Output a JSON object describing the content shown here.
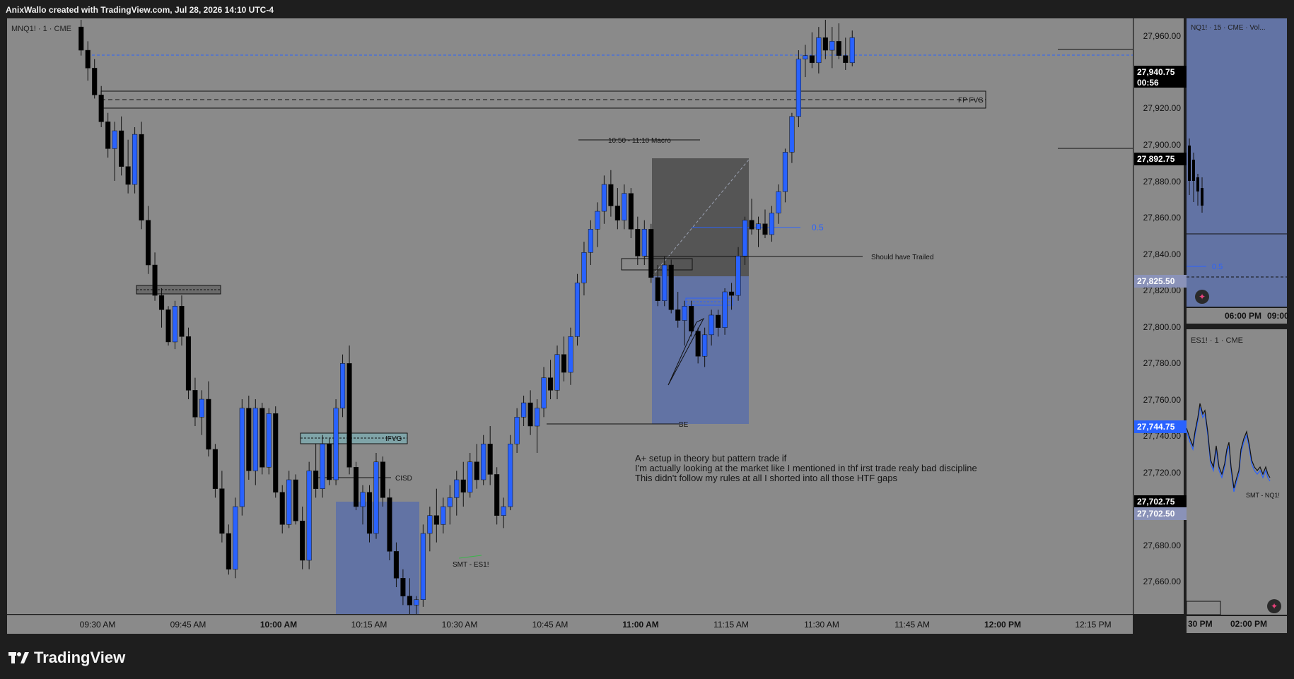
{
  "header": {
    "title": "AnixWallo created with TradingView.com, Jul 28, 2026 14:10 UTC-4"
  },
  "main": {
    "symbol": "MNQ1! · 1 · CME",
    "annotations": {
      "fp_fvg": "FP FVG",
      "macro": "10:50 - 11:10 Macro",
      "fib": "0.5",
      "trailed": "Should have Trailed",
      "ifvg": "IFVG",
      "cisd": "CISD",
      "be": "BE",
      "smt": "SMT - ES1!"
    },
    "note_lines": [
      "A+ setup in theory but pattern trade if",
      "I'm actually looking at the market like I mentioned in thf irst trade realy bad discipline",
      "This didn't follow my rules at all I shorted into all those HTF gaps"
    ]
  },
  "price_axis": {
    "ticks": [
      "27,960.00",
      "27,920.00",
      "27,900.00",
      "27,880.00",
      "27,860.00",
      "27,840.00",
      "27,820.00",
      "27,800.00",
      "27,780.00",
      "27,760.00",
      "27,740.00",
      "27,720.00",
      "27,680.00",
      "27,660.00"
    ],
    "tags": {
      "last": "27,940.75",
      "countdown": "00:56",
      "level_1": "27,892.75",
      "level_2": "27,825.50",
      "level_3": "27,744.75",
      "level_4": "27,702.75",
      "level_5": "27,702.50"
    }
  },
  "time_axis": {
    "ticks": [
      {
        "label": "09:30 AM",
        "bold": false
      },
      {
        "label": "09:45 AM",
        "bold": false
      },
      {
        "label": "10:00 AM",
        "bold": true
      },
      {
        "label": "10:15 AM",
        "bold": false
      },
      {
        "label": "10:30 AM",
        "bold": false
      },
      {
        "label": "10:45 AM",
        "bold": false
      },
      {
        "label": "11:00 AM",
        "bold": true
      },
      {
        "label": "11:15 AM",
        "bold": false
      },
      {
        "label": "11:30 AM",
        "bold": false
      },
      {
        "label": "11:45 AM",
        "bold": false
      },
      {
        "label": "12:00 PM",
        "bold": true
      },
      {
        "label": "12:15 PM",
        "bold": false
      }
    ]
  },
  "side_top": {
    "symbol": "NQ1! · 15 · CME · Vol...",
    "fib": "0.5",
    "time_left": "06:00 PM",
    "time_right": "09:00"
  },
  "side_bottom": {
    "symbol": "ES1! · 1 · CME",
    "smt": "SMT - NQ1!",
    "time_left": "30 PM",
    "time_right": "02:00 PM"
  },
  "brand": {
    "name": "TradingView"
  },
  "colors": {
    "up": "#2962ff",
    "down": "#000000",
    "pane": "#8a8a8a",
    "zone": "#5b6ea8"
  },
  "chart_data": {
    "type": "candlestick",
    "symbol": "MNQ1!",
    "interval": "1",
    "ylim": [
      27640,
      27972
    ],
    "x_ticks": [
      "09:30 AM",
      "09:45 AM",
      "10:00 AM",
      "10:15 AM",
      "10:30 AM",
      "10:45 AM",
      "11:00 AM",
      "11:15 AM",
      "11:30 AM",
      "11:45 AM",
      "12:00 PM",
      "12:15 PM"
    ],
    "candles": [
      [
        27968,
        27972,
        27952,
        27955
      ],
      [
        27955,
        27960,
        27938,
        27945
      ],
      [
        27945,
        27950,
        27928,
        27930
      ],
      [
        27930,
        27935,
        27912,
        27915
      ],
      [
        27915,
        27920,
        27895,
        27900
      ],
      [
        27900,
        27915,
        27882,
        27910
      ],
      [
        27910,
        27918,
        27885,
        27890
      ],
      [
        27890,
        27905,
        27875,
        27880
      ],
      [
        27880,
        27912,
        27875,
        27908
      ],
      [
        27908,
        27915,
        27855,
        27860
      ],
      [
        27860,
        27868,
        27830,
        27835
      ],
      [
        27835,
        27842,
        27815,
        27818
      ],
      [
        27818,
        27822,
        27800,
        27810
      ],
      [
        27810,
        27812,
        27790,
        27792
      ],
      [
        27792,
        27815,
        27788,
        27812
      ],
      [
        27812,
        27818,
        27790,
        27795
      ],
      [
        27795,
        27800,
        27760,
        27765
      ],
      [
        27765,
        27772,
        27745,
        27750
      ],
      [
        27750,
        27765,
        27740,
        27760
      ],
      [
        27760,
        27770,
        27728,
        27732
      ],
      [
        27732,
        27735,
        27705,
        27710
      ],
      [
        27710,
        27720,
        27680,
        27685
      ],
      [
        27685,
        27690,
        27662,
        27665
      ],
      [
        27665,
        27705,
        27660,
        27700
      ],
      [
        27700,
        27760,
        27695,
        27755
      ],
      [
        27755,
        27762,
        27715,
        27720
      ],
      [
        27720,
        27760,
        27712,
        27755
      ],
      [
        27755,
        27758,
        27718,
        27722
      ],
      [
        27722,
        27755,
        27718,
        27752
      ],
      [
        27752,
        27756,
        27705,
        27708
      ],
      [
        27708,
        27712,
        27685,
        27690
      ],
      [
        27690,
        27720,
        27688,
        27715
      ],
      [
        27715,
        27718,
        27690,
        27692
      ],
      [
        27692,
        27700,
        27665,
        27670
      ],
      [
        27670,
        27725,
        27665,
        27720
      ],
      [
        27720,
        27735,
        27705,
        27710
      ],
      [
        27710,
        27740,
        27705,
        27735
      ],
      [
        27735,
        27738,
        27712,
        27715
      ],
      [
        27715,
        27760,
        27712,
        27755
      ],
      [
        27755,
        27785,
        27750,
        27780
      ],
      [
        27780,
        27790,
        27718,
        27722
      ],
      [
        27722,
        27725,
        27698,
        27700
      ],
      [
        27700,
        27712,
        27690,
        27708
      ],
      [
        27708,
        27712,
        27680,
        27685
      ],
      [
        27685,
        27730,
        27682,
        27725
      ],
      [
        27725,
        27728,
        27700,
        27705
      ],
      [
        27705,
        27710,
        27670,
        27675
      ],
      [
        27675,
        27680,
        27655,
        27660
      ],
      [
        27660,
        27665,
        27645,
        27650
      ],
      [
        27650,
        27660,
        27640,
        27645
      ],
      [
        27645,
        27650,
        27640,
        27648
      ],
      [
        27648,
        27690,
        27644,
        27685
      ],
      [
        27685,
        27700,
        27675,
        27695
      ],
      [
        27695,
        27710,
        27680,
        27690
      ],
      [
        27690,
        27705,
        27685,
        27700
      ],
      [
        27700,
        27712,
        27690,
        27705
      ],
      [
        27705,
        27720,
        27695,
        27715
      ],
      [
        27715,
        27725,
        27700,
        27708
      ],
      [
        27708,
        27730,
        27705,
        27725
      ],
      [
        27725,
        27735,
        27710,
        27715
      ],
      [
        27715,
        27740,
        27712,
        27735
      ],
      [
        27735,
        27745,
        27712,
        27718
      ],
      [
        27718,
        27722,
        27690,
        27695
      ],
      [
        27695,
        27705,
        27688,
        27700
      ],
      [
        27700,
        27740,
        27698,
        27735
      ],
      [
        27735,
        27755,
        27730,
        27750
      ],
      [
        27750,
        27762,
        27745,
        27758
      ],
      [
        27758,
        27765,
        27740,
        27745
      ],
      [
        27745,
        27760,
        27730,
        27755
      ],
      [
        27755,
        27778,
        27750,
        27772
      ],
      [
        27772,
        27782,
        27760,
        27765
      ],
      [
        27765,
        27790,
        27760,
        27785
      ],
      [
        27785,
        27795,
        27770,
        27775
      ],
      [
        27775,
        27800,
        27768,
        27795
      ],
      [
        27795,
        27830,
        27790,
        27825
      ],
      [
        27825,
        27848,
        27818,
        27842
      ],
      [
        27842,
        27860,
        27835,
        27855
      ],
      [
        27855,
        27870,
        27845,
        27865
      ],
      [
        27865,
        27885,
        27858,
        27880
      ],
      [
        27880,
        27888,
        27862,
        27868
      ],
      [
        27868,
        27878,
        27855,
        27860
      ],
      [
        27860,
        27880,
        27855,
        27875
      ],
      [
        27875,
        27878,
        27850,
        27855
      ],
      [
        27855,
        27862,
        27835,
        27840
      ],
      [
        27840,
        27860,
        27835,
        27855
      ],
      [
        27855,
        27858,
        27825,
        27828
      ],
      [
        27828,
        27835,
        27812,
        27815
      ],
      [
        27815,
        27840,
        27812,
        27835
      ],
      [
        27835,
        27838,
        27808,
        27810
      ],
      [
        27810,
        27820,
        27800,
        27804
      ],
      [
        27804,
        27815,
        27790,
        27812
      ],
      [
        27812,
        27815,
        27795,
        27798
      ],
      [
        27798,
        27800,
        27780,
        27784
      ],
      [
        27784,
        27800,
        27778,
        27796
      ],
      [
        27796,
        27810,
        27790,
        27807
      ],
      [
        27807,
        27810,
        27795,
        27800
      ],
      [
        27800,
        27822,
        27796,
        27820
      ],
      [
        27820,
        27825,
        27810,
        27818
      ],
      [
        27818,
        27845,
        27815,
        27840
      ],
      [
        27840,
        27862,
        27835,
        27860
      ],
      [
        27860,
        27872,
        27852,
        27855
      ],
      [
        27855,
        27862,
        27845,
        27858
      ],
      [
        27858,
        27866,
        27850,
        27852
      ],
      [
        27852,
        27868,
        27848,
        27864
      ],
      [
        27864,
        27880,
        27858,
        27876
      ],
      [
        27876,
        27900,
        27870,
        27898
      ],
      [
        27898,
        27920,
        27892,
        27918
      ],
      [
        27918,
        27955,
        27912,
        27950
      ],
      [
        27950,
        27958,
        27940,
        27952
      ],
      [
        27952,
        27965,
        27945,
        27948
      ],
      [
        27948,
        27968,
        27942,
        27962
      ],
      [
        27962,
        27972,
        27950,
        27955
      ],
      [
        27955,
        27968,
        27945,
        27960
      ],
      [
        27960,
        27970,
        27950,
        27952
      ],
      [
        27952,
        27962,
        27944,
        27948
      ],
      [
        27948,
        27966,
        27946,
        27962
      ]
    ],
    "levels": [
      27892.75,
      27825.5,
      27744.75,
      27702.75,
      27702.5
    ],
    "last_price": 27940.75
  }
}
